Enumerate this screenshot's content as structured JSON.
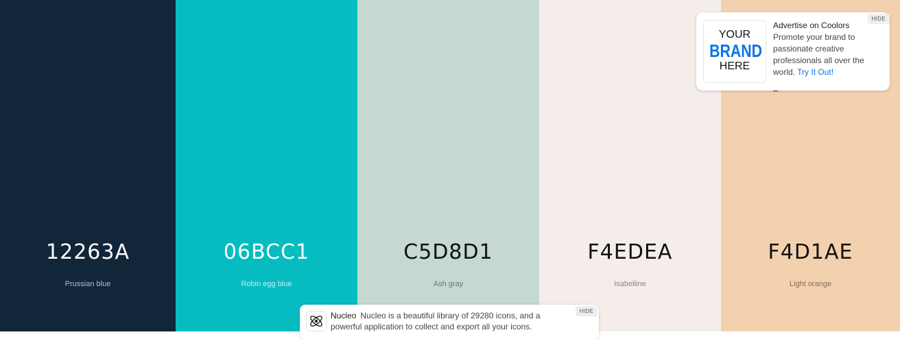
{
  "palette": [
    {
      "hex": "12263A",
      "name": "Prussian blue",
      "bg": "#12263A",
      "hex_color": "#ffffff",
      "name_color": "#b7bfc8"
    },
    {
      "hex": "06BCC1",
      "name": "Robin egg blue",
      "bg": "#06BCC1",
      "hex_color": "#ffffff",
      "name_color": "#c4eff0"
    },
    {
      "hex": "C5D8D1",
      "name": "Ash gray",
      "bg": "#C5D8D1",
      "hex_color": "#111111",
      "name_color": "#6d7773"
    },
    {
      "hex": "F4EDEA",
      "name": "Isabelline",
      "bg": "#F4EDEA",
      "hex_color": "#111111",
      "name_color": "#8a8583"
    },
    {
      "hex": "F4D1AE",
      "name": "Light orange",
      "bg": "#F4D1AE",
      "hex_color": "#111111",
      "name_color": "#7d6b59"
    }
  ],
  "ad": {
    "logo_line1": "YOUR",
    "logo_line2": "BRAND",
    "logo_line3": "HERE",
    "title": "Advertise on Coolors",
    "body": "Promote your brand to passionate creative professionals all over the world.",
    "link": "Try It Out!",
    "hide_label": "HIDE"
  },
  "nucleo": {
    "icon": "atom-icon",
    "brand": "Nucleo",
    "text": "Nucleo is a beautiful library of 29280 icons, and a powerful application to collect and export all your icons.",
    "hide_label": "HIDE"
  }
}
